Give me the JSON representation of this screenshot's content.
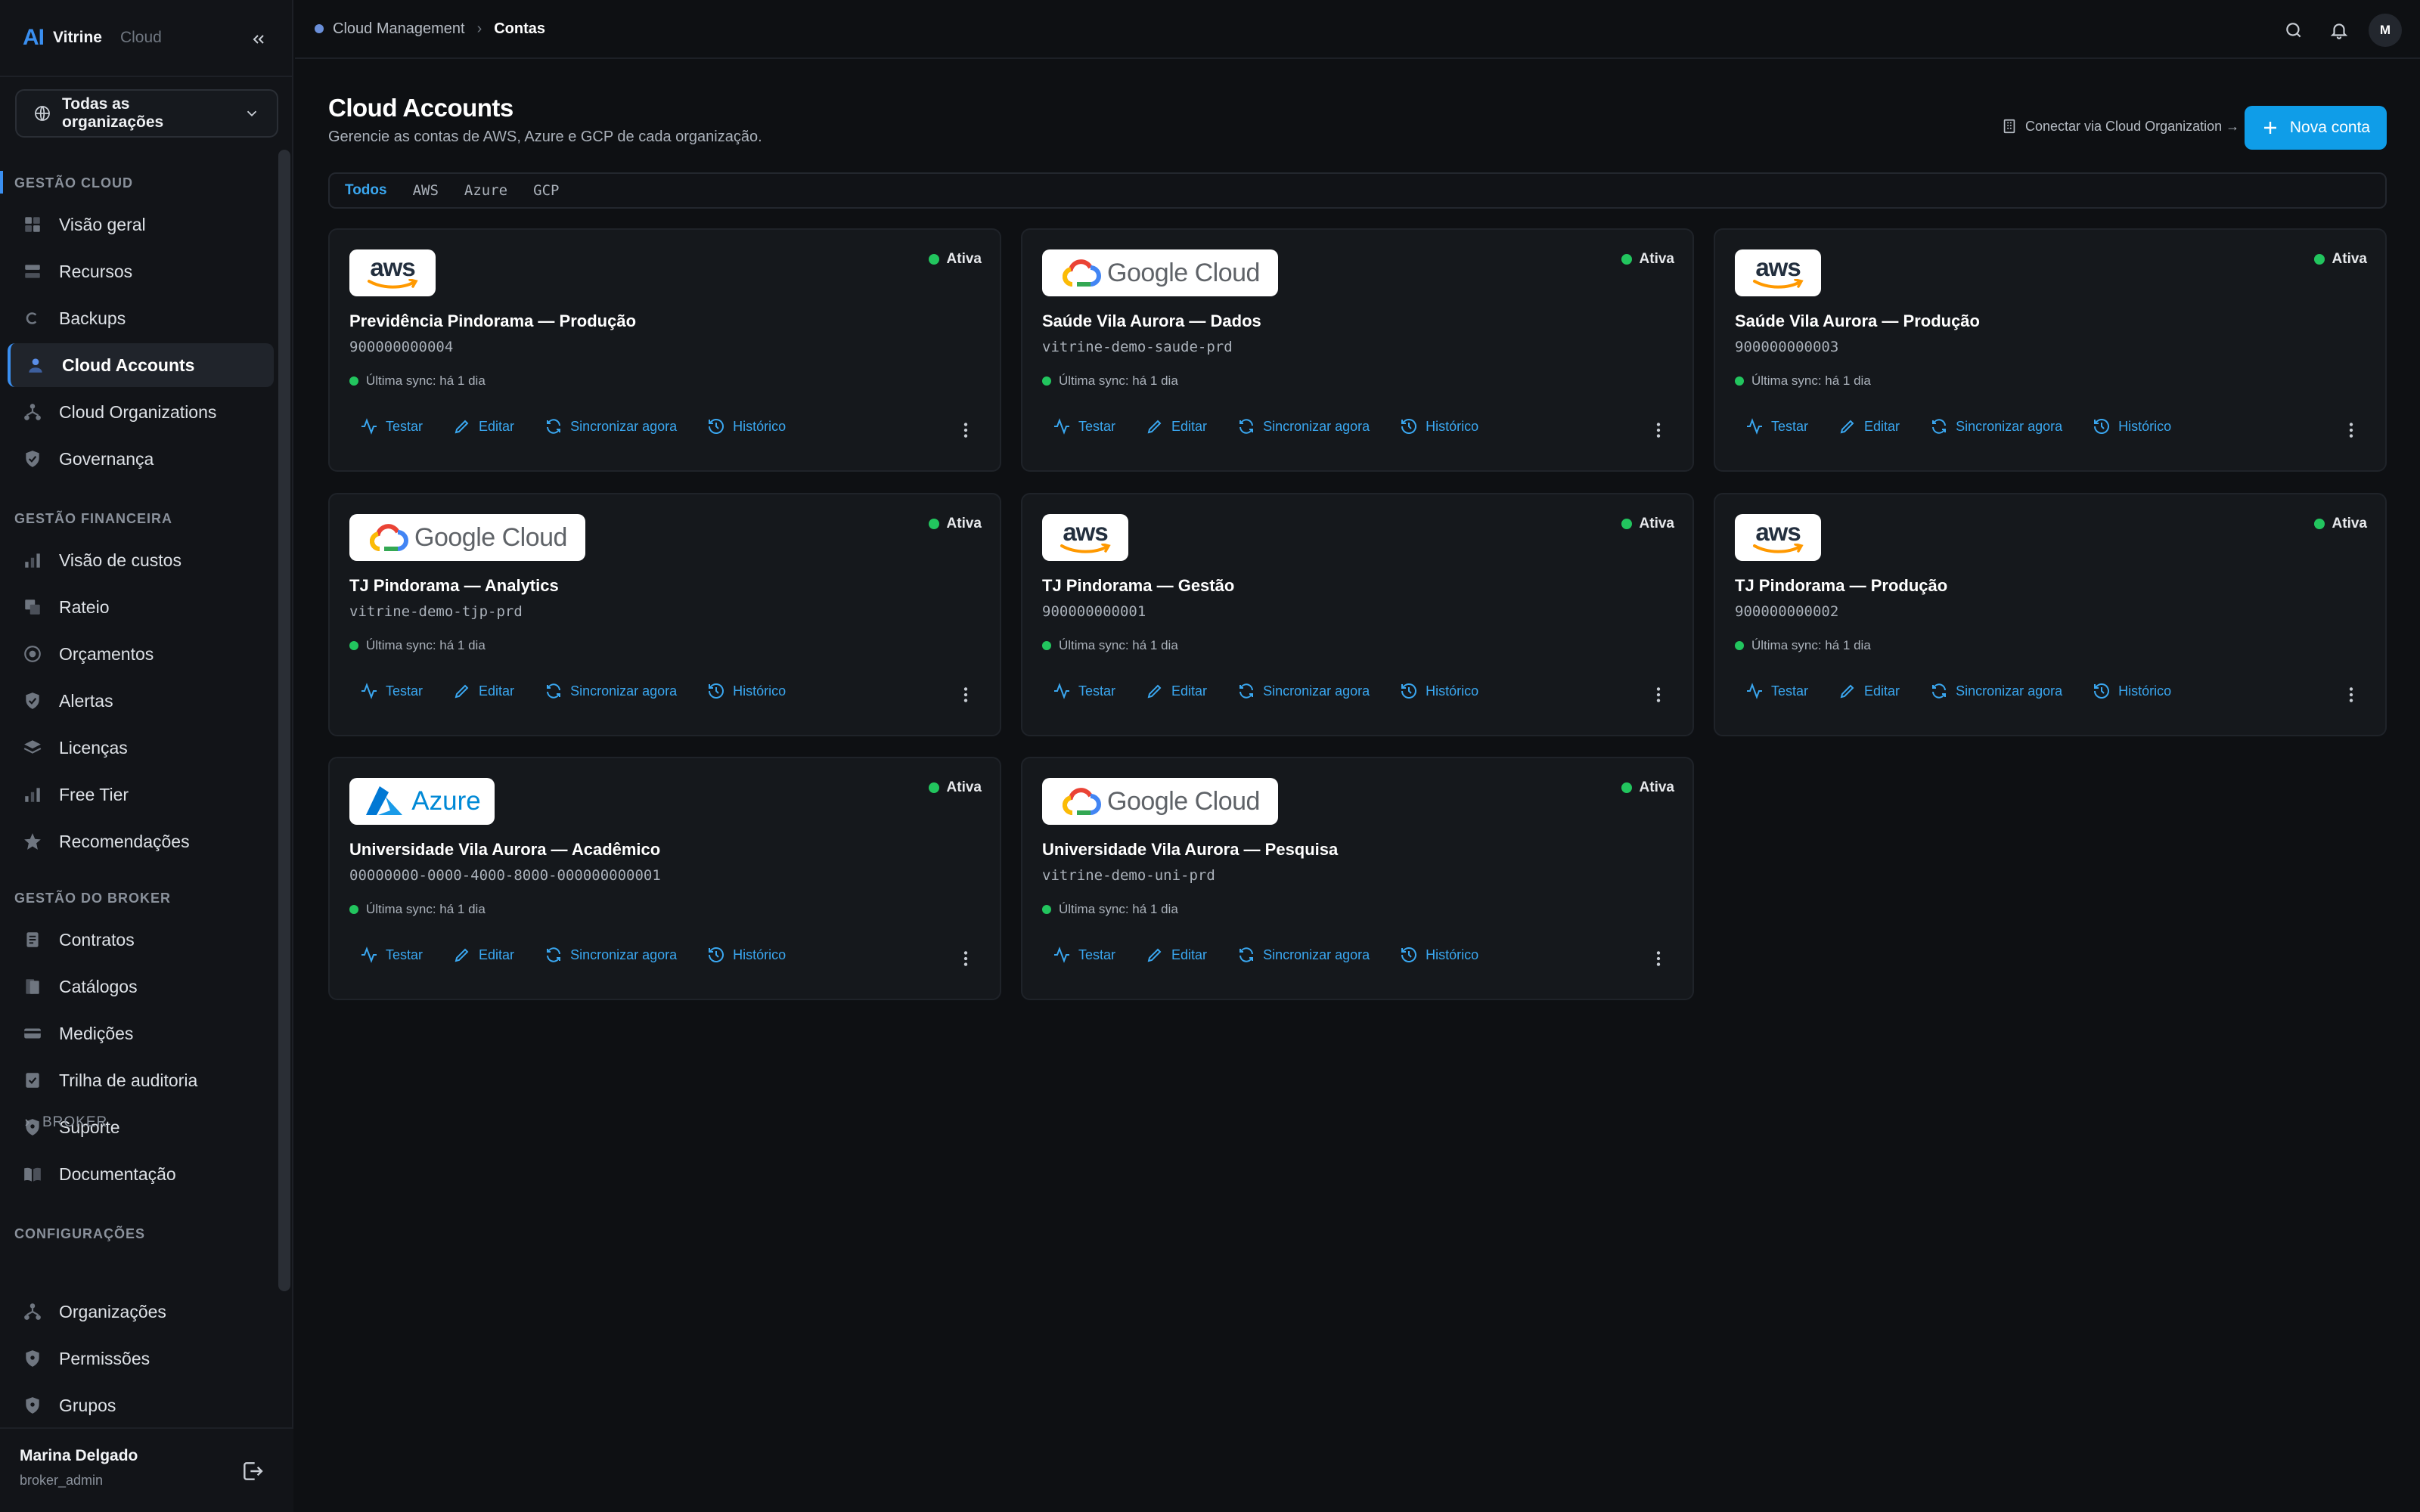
{
  "app": {
    "logo_mark": "AI",
    "name": "Vitrine",
    "sub": "Cloud"
  },
  "org_selector": {
    "label": "Todas as organizações"
  },
  "sidebar": {
    "sections": {
      "cloud": "GESTÃO CLOUD",
      "financeira": "GESTÃO FINANCEIRA",
      "broker": "GESTÃO DO BROKER",
      "config": "CONFIGURAÇÕES"
    },
    "cloud_items": [
      "Visão geral",
      "Recursos",
      "Backups",
      "Cloud Accounts",
      "Cloud Organizations",
      "Governança"
    ],
    "fin_items": [
      "Visão de custos",
      "Rateio",
      "Orçamentos",
      "Alertas",
      "Licenças",
      "Free Tier",
      "Recomendações"
    ],
    "broker_items": [
      "Contratos",
      "Catálogos",
      "Medições",
      "Trilha de auditoria",
      "Suporte",
      "Documentação"
    ],
    "config_sub": "BROKER",
    "config_items": [
      "Organizações",
      "Permissões",
      "Grupos"
    ]
  },
  "user": {
    "name": "Marina Delgado",
    "role": "broker_admin",
    "avatar": "M"
  },
  "breadcrumb": {
    "parent": "Cloud Management",
    "current": "Contas"
  },
  "page": {
    "title": "Cloud Accounts",
    "subtitle": "Gerencie as contas de AWS, Azure e GCP de cada organização.",
    "connect_link": "Conectar via Cloud Organization →",
    "new_button": "Nova conta"
  },
  "tabs": [
    "Todos",
    "AWS",
    "Azure",
    "GCP"
  ],
  "cards": [
    {
      "provider": "aws",
      "logo_text": "aws",
      "name": "Previdência Pindorama — Produção",
      "id": "900000000004",
      "status": "Ativa",
      "sync": "Última sync: há 1 dia"
    },
    {
      "provider": "gcp",
      "logo_text": "Google Cloud",
      "name": "Saúde Vila Aurora — Dados",
      "id": "vitrine-demo-saude-prd",
      "status": "Ativa",
      "sync": "Última sync: há 1 dia"
    },
    {
      "provider": "aws",
      "logo_text": "aws",
      "name": "Saúde Vila Aurora — Produção",
      "id": "900000000003",
      "status": "Ativa",
      "sync": "Última sync: há 1 dia"
    },
    {
      "provider": "gcp",
      "logo_text": "Google Cloud",
      "name": "TJ Pindorama — Analytics",
      "id": "vitrine-demo-tjp-prd",
      "status": "Ativa",
      "sync": "Última sync: há 1 dia"
    },
    {
      "provider": "aws",
      "logo_text": "aws",
      "name": "TJ Pindorama — Gestão",
      "id": "900000000001",
      "status": "Ativa",
      "sync": "Última sync: há 1 dia"
    },
    {
      "provider": "aws",
      "logo_text": "aws",
      "name": "TJ Pindorama — Produção",
      "id": "900000000002",
      "status": "Ativa",
      "sync": "Última sync: há 1 dia"
    },
    {
      "provider": "azure",
      "logo_text": "Azure",
      "name": "Universidade Vila Aurora — Acadêmico",
      "id": "00000000-0000-4000-8000-000000000001",
      "status": "Ativa",
      "sync": "Última sync: há 1 dia"
    },
    {
      "provider": "gcp",
      "logo_text": "Google Cloud",
      "name": "Universidade Vila Aurora — Pesquisa",
      "id": "vitrine-demo-uni-prd",
      "status": "Ativa",
      "sync": "Última sync: há 1 dia"
    }
  ],
  "card_actions": {
    "test": "Testar",
    "edit": "Editar",
    "sync": "Sincronizar agora",
    "history": "Histórico"
  },
  "colors": {
    "accent": "#0f9de8",
    "link": "#3aa7f0",
    "status_ok": "#22c55e",
    "background": "#0e1013"
  }
}
